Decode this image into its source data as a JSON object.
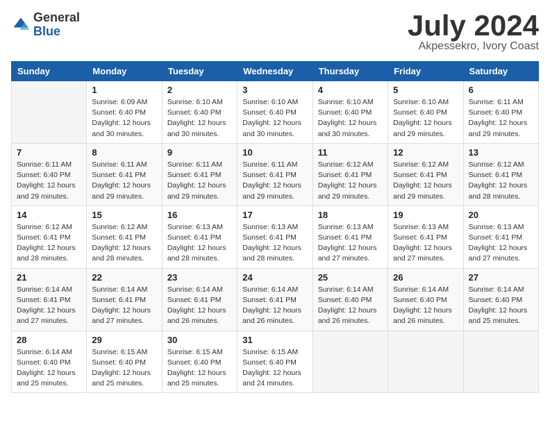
{
  "header": {
    "logo_general": "General",
    "logo_blue": "Blue",
    "month_title": "July 2024",
    "location": "Akpessekro, Ivory Coast"
  },
  "days_of_week": [
    "Sunday",
    "Monday",
    "Tuesday",
    "Wednesday",
    "Thursday",
    "Friday",
    "Saturday"
  ],
  "weeks": [
    [
      {
        "day": "",
        "sunrise": "",
        "sunset": "",
        "daylight": ""
      },
      {
        "day": "1",
        "sunrise": "Sunrise: 6:09 AM",
        "sunset": "Sunset: 6:40 PM",
        "daylight": "Daylight: 12 hours and 30 minutes."
      },
      {
        "day": "2",
        "sunrise": "Sunrise: 6:10 AM",
        "sunset": "Sunset: 6:40 PM",
        "daylight": "Daylight: 12 hours and 30 minutes."
      },
      {
        "day": "3",
        "sunrise": "Sunrise: 6:10 AM",
        "sunset": "Sunset: 6:40 PM",
        "daylight": "Daylight: 12 hours and 30 minutes."
      },
      {
        "day": "4",
        "sunrise": "Sunrise: 6:10 AM",
        "sunset": "Sunset: 6:40 PM",
        "daylight": "Daylight: 12 hours and 30 minutes."
      },
      {
        "day": "5",
        "sunrise": "Sunrise: 6:10 AM",
        "sunset": "Sunset: 6:40 PM",
        "daylight": "Daylight: 12 hours and 29 minutes."
      },
      {
        "day": "6",
        "sunrise": "Sunrise: 6:11 AM",
        "sunset": "Sunset: 6:40 PM",
        "daylight": "Daylight: 12 hours and 29 minutes."
      }
    ],
    [
      {
        "day": "7",
        "sunrise": "Sunrise: 6:11 AM",
        "sunset": "Sunset: 6:40 PM",
        "daylight": "Daylight: 12 hours and 29 minutes."
      },
      {
        "day": "8",
        "sunrise": "Sunrise: 6:11 AM",
        "sunset": "Sunset: 6:41 PM",
        "daylight": "Daylight: 12 hours and 29 minutes."
      },
      {
        "day": "9",
        "sunrise": "Sunrise: 6:11 AM",
        "sunset": "Sunset: 6:41 PM",
        "daylight": "Daylight: 12 hours and 29 minutes."
      },
      {
        "day": "10",
        "sunrise": "Sunrise: 6:11 AM",
        "sunset": "Sunset: 6:41 PM",
        "daylight": "Daylight: 12 hours and 29 minutes."
      },
      {
        "day": "11",
        "sunrise": "Sunrise: 6:12 AM",
        "sunset": "Sunset: 6:41 PM",
        "daylight": "Daylight: 12 hours and 29 minutes."
      },
      {
        "day": "12",
        "sunrise": "Sunrise: 6:12 AM",
        "sunset": "Sunset: 6:41 PM",
        "daylight": "Daylight: 12 hours and 29 minutes."
      },
      {
        "day": "13",
        "sunrise": "Sunrise: 6:12 AM",
        "sunset": "Sunset: 6:41 PM",
        "daylight": "Daylight: 12 hours and 28 minutes."
      }
    ],
    [
      {
        "day": "14",
        "sunrise": "Sunrise: 6:12 AM",
        "sunset": "Sunset: 6:41 PM",
        "daylight": "Daylight: 12 hours and 28 minutes."
      },
      {
        "day": "15",
        "sunrise": "Sunrise: 6:12 AM",
        "sunset": "Sunset: 6:41 PM",
        "daylight": "Daylight: 12 hours and 28 minutes."
      },
      {
        "day": "16",
        "sunrise": "Sunrise: 6:13 AM",
        "sunset": "Sunset: 6:41 PM",
        "daylight": "Daylight: 12 hours and 28 minutes."
      },
      {
        "day": "17",
        "sunrise": "Sunrise: 6:13 AM",
        "sunset": "Sunset: 6:41 PM",
        "daylight": "Daylight: 12 hours and 28 minutes."
      },
      {
        "day": "18",
        "sunrise": "Sunrise: 6:13 AM",
        "sunset": "Sunset: 6:41 PM",
        "daylight": "Daylight: 12 hours and 27 minutes."
      },
      {
        "day": "19",
        "sunrise": "Sunrise: 6:13 AM",
        "sunset": "Sunset: 6:41 PM",
        "daylight": "Daylight: 12 hours and 27 minutes."
      },
      {
        "day": "20",
        "sunrise": "Sunrise: 6:13 AM",
        "sunset": "Sunset: 6:41 PM",
        "daylight": "Daylight: 12 hours and 27 minutes."
      }
    ],
    [
      {
        "day": "21",
        "sunrise": "Sunrise: 6:14 AM",
        "sunset": "Sunset: 6:41 PM",
        "daylight": "Daylight: 12 hours and 27 minutes."
      },
      {
        "day": "22",
        "sunrise": "Sunrise: 6:14 AM",
        "sunset": "Sunset: 6:41 PM",
        "daylight": "Daylight: 12 hours and 27 minutes."
      },
      {
        "day": "23",
        "sunrise": "Sunrise: 6:14 AM",
        "sunset": "Sunset: 6:41 PM",
        "daylight": "Daylight: 12 hours and 26 minutes."
      },
      {
        "day": "24",
        "sunrise": "Sunrise: 6:14 AM",
        "sunset": "Sunset: 6:41 PM",
        "daylight": "Daylight: 12 hours and 26 minutes."
      },
      {
        "day": "25",
        "sunrise": "Sunrise: 6:14 AM",
        "sunset": "Sunset: 6:40 PM",
        "daylight": "Daylight: 12 hours and 26 minutes."
      },
      {
        "day": "26",
        "sunrise": "Sunrise: 6:14 AM",
        "sunset": "Sunset: 6:40 PM",
        "daylight": "Daylight: 12 hours and 26 minutes."
      },
      {
        "day": "27",
        "sunrise": "Sunrise: 6:14 AM",
        "sunset": "Sunset: 6:40 PM",
        "daylight": "Daylight: 12 hours and 25 minutes."
      }
    ],
    [
      {
        "day": "28",
        "sunrise": "Sunrise: 6:14 AM",
        "sunset": "Sunset: 6:40 PM",
        "daylight": "Daylight: 12 hours and 25 minutes."
      },
      {
        "day": "29",
        "sunrise": "Sunrise: 6:15 AM",
        "sunset": "Sunset: 6:40 PM",
        "daylight": "Daylight: 12 hours and 25 minutes."
      },
      {
        "day": "30",
        "sunrise": "Sunrise: 6:15 AM",
        "sunset": "Sunset: 6:40 PM",
        "daylight": "Daylight: 12 hours and 25 minutes."
      },
      {
        "day": "31",
        "sunrise": "Sunrise: 6:15 AM",
        "sunset": "Sunset: 6:40 PM",
        "daylight": "Daylight: 12 hours and 24 minutes."
      },
      {
        "day": "",
        "sunrise": "",
        "sunset": "",
        "daylight": ""
      },
      {
        "day": "",
        "sunrise": "",
        "sunset": "",
        "daylight": ""
      },
      {
        "day": "",
        "sunrise": "",
        "sunset": "",
        "daylight": ""
      }
    ]
  ]
}
